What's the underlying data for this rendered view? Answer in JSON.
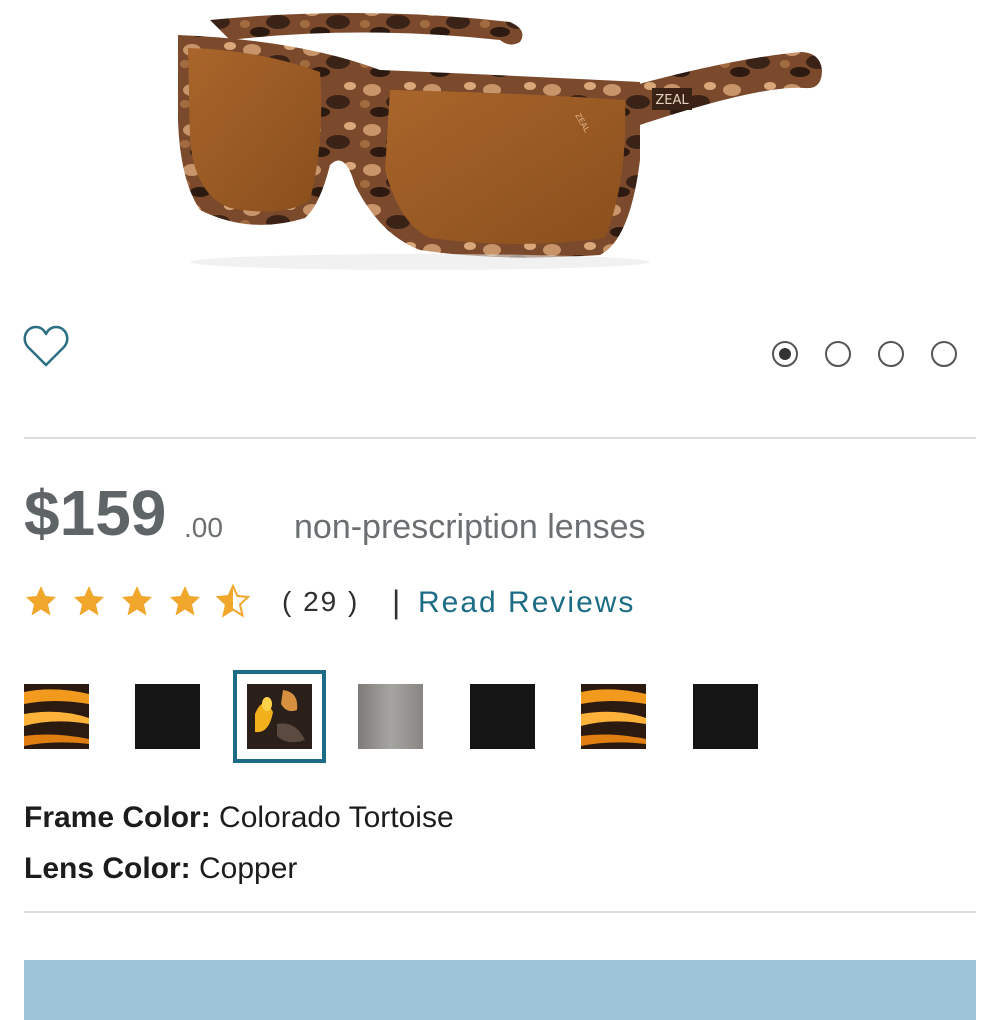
{
  "product": {
    "image_alt": "Zeal tortoise sunglasses with copper lenses",
    "brand_mark": "ZEAL",
    "price_main": "$159",
    "price_cents": ".00",
    "price_note": "non-prescription lenses"
  },
  "rating": {
    "stars": 4.5,
    "count_label": "( 29 )",
    "separator": "|",
    "reviews_link": "Read Reviews"
  },
  "gallery": {
    "dots": [
      "image-1",
      "image-2",
      "image-3",
      "image-4"
    ],
    "active_index": 0
  },
  "swatches": {
    "selected_index": 2,
    "items": [
      "amber-tortoise",
      "black",
      "colorado-tortoise",
      "grey",
      "black",
      "amber-tortoise",
      "black"
    ]
  },
  "details": {
    "frame_label": "Frame Color:",
    "frame_value": "Colorado Tortoise",
    "lens_label": "Lens Color:",
    "lens_value": "Copper"
  },
  "colors": {
    "accent": "#1d6c86",
    "star": "#f0a72b",
    "cta": "#9cc4d6"
  },
  "icons": {
    "wishlist": "heart-outline-icon"
  }
}
